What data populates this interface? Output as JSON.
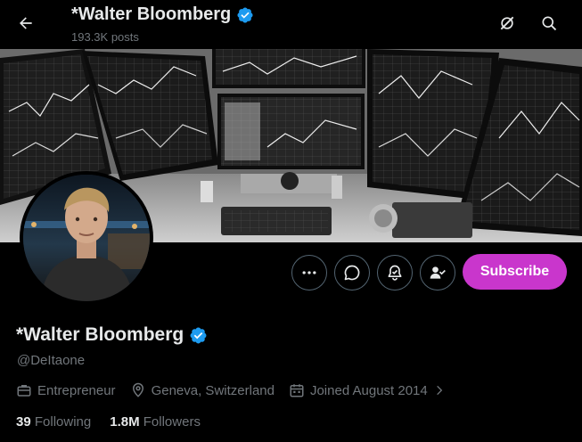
{
  "header": {
    "name": "*Walter Bloomberg",
    "posts": "193.3K posts"
  },
  "profile": {
    "name": "*Walter Bloomberg",
    "handle": "@DeItaone",
    "profession": "Entrepreneur",
    "location": "Geneva, Switzerland",
    "joined": "Joined August 2014"
  },
  "actions": {
    "subscribe_label": "Subscribe"
  },
  "stats": {
    "following_count": "39",
    "following_label": "Following",
    "followers_count": "1.8M",
    "followers_label": "Followers"
  },
  "colors": {
    "verified": "#1d9bf0",
    "subscribe_bg": "#c936cc",
    "muted_text": "#71767b"
  },
  "icons": [
    "back-arrow-icon",
    "verified-badge-icon",
    "grok-icon",
    "search-icon",
    "more-icon",
    "message-icon",
    "notification-bell-icon",
    "following-user-icon",
    "briefcase-icon",
    "location-pin-icon",
    "calendar-icon",
    "chevron-right-icon"
  ]
}
